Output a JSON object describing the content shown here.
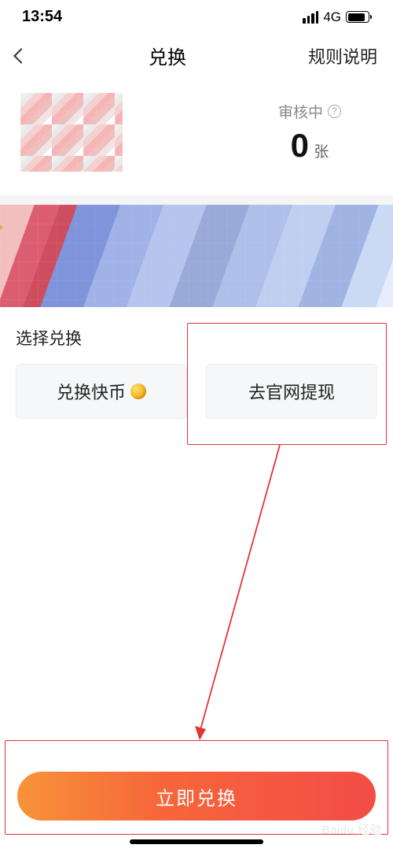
{
  "status": {
    "time": "13:54",
    "network": "4G"
  },
  "header": {
    "title": "兑换",
    "rules_label": "规则说明"
  },
  "review": {
    "label": "审核中",
    "count": "0",
    "unit": "张"
  },
  "section": {
    "label": "选择兑换"
  },
  "options": {
    "coin": "兑换快币",
    "withdraw": "去官网提现"
  },
  "cta": {
    "label": "立即兑换"
  },
  "watermark": "Baidu 经验"
}
